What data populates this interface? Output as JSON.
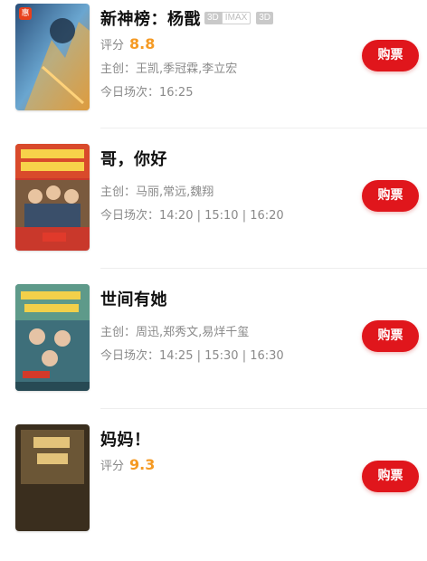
{
  "movies": [
    {
      "title": "新神榜：杨戬",
      "tags": [
        "3D",
        "IMAX",
        "3D"
      ],
      "rating_label": "评分",
      "rating": "8.8",
      "cast": "主创：王凯,季冠霖,李立宏",
      "showtimes": "今日场次：16:25",
      "poster_badge": "惠",
      "button": "购票"
    },
    {
      "title": "哥，你好",
      "cast": "主创：马丽,常远,魏翔",
      "showtimes": "今日场次：14:20 | 15:10 | 16:20",
      "button": "购票"
    },
    {
      "title": "世间有她",
      "cast": "主创：周迅,郑秀文,易烊千玺",
      "showtimes": "今日场次：14:25 | 15:30 | 16:30",
      "button": "购票"
    },
    {
      "title": "妈妈！",
      "rating_label": "评分",
      "rating": "9.3",
      "button": "购票"
    }
  ],
  "colors": {
    "accent": "#e0161c",
    "score": "#f59a23"
  }
}
